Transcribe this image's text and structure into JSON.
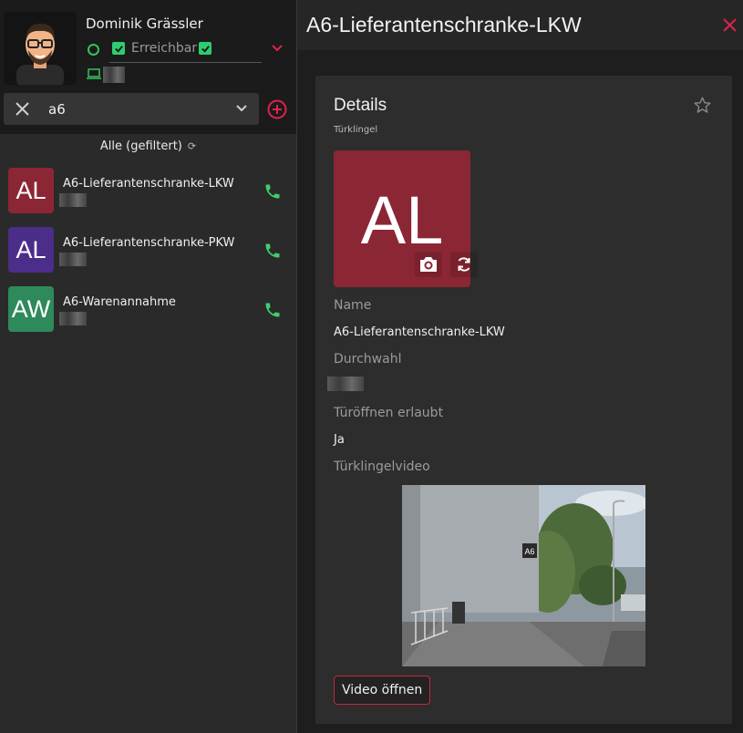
{
  "user": {
    "name": "Dominik Grässler",
    "status": "Erreichbar"
  },
  "search": {
    "value": "a6"
  },
  "filter": {
    "label": "Alle (gefiltert)"
  },
  "contacts": [
    {
      "initials": "AL",
      "name": "A6-Lieferantenschranke-LKW",
      "color": "#8b2635"
    },
    {
      "initials": "AL",
      "name": "A6-Lieferantenschranke-PKW",
      "color": "#4b2d8a"
    },
    {
      "initials": "AW",
      "name": "A6-Warenannahme",
      "color": "#2e8a5a"
    }
  ],
  "header": {
    "title": "A6-Lieferantenschranke-LKW"
  },
  "details": {
    "title": "Details",
    "subtitle": "Türklingel",
    "initials": "AL",
    "name_label": "Name",
    "name_value": "A6-Lieferantenschranke-LKW",
    "extension_label": "Durchwahl",
    "door_label": "Türöffnen erlaubt",
    "door_value": "Ja",
    "video_label": "Türklingelvideo",
    "video_sign": "A6",
    "video_button": "Video öffnen"
  },
  "colors": {
    "accent": "#e0224a",
    "online": "#35c35a",
    "brand_avatar": "#8b2635"
  }
}
